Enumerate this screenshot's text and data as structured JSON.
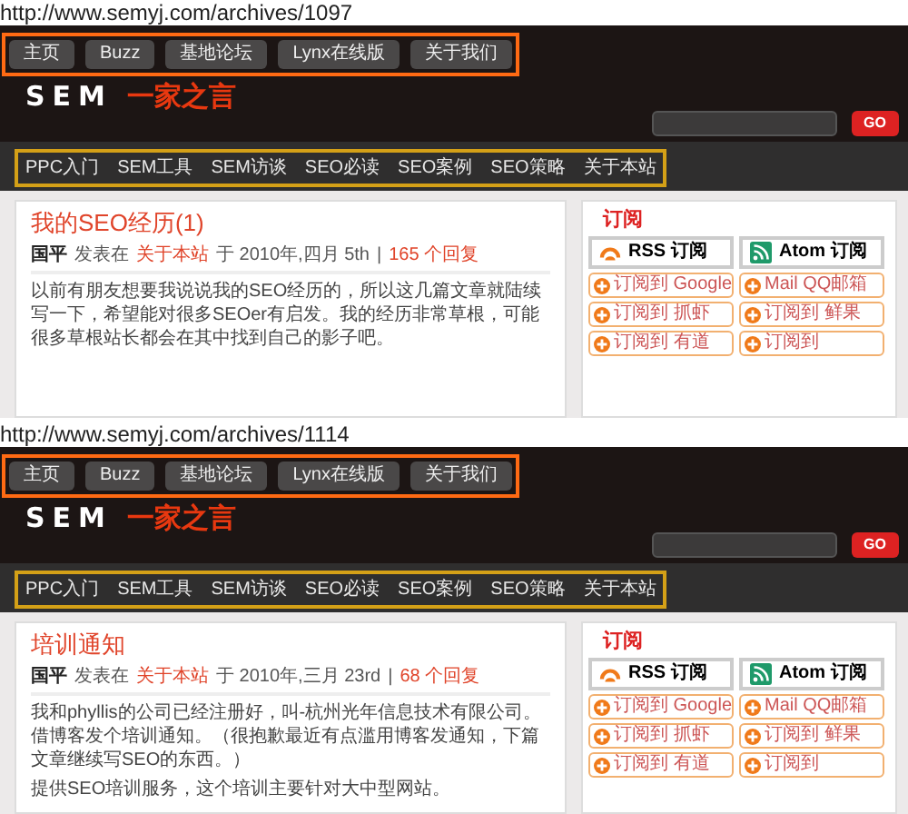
{
  "screenshots": [
    {
      "url": "http://www.semyj.com/archives/1097",
      "top_nav": [
        "主页",
        "Buzz",
        "基地论坛",
        "Lynx在线版",
        "关于我们"
      ],
      "logo": {
        "name": "SEM",
        "tagline": "一家之言"
      },
      "search_button": "GO",
      "sub_nav": [
        "PPC入门",
        "SEM工具",
        "SEM访谈",
        "SEO必读",
        "SEO案例",
        "SEO策略",
        "关于本站"
      ],
      "post": {
        "title": "我的SEO经历(1)",
        "author": "国平",
        "posted_in": "发表在",
        "category": "关于本站",
        "date": "于 2010年,四月 5th",
        "separator": "|",
        "comments": "165 个回复",
        "paragraphs": [
          "以前有朋友想要我说说我的SEO经历的，所以这几篇文章就陆续写一下，希望能对很多SEOer有启发。我的经历非常草根，可能很多草根站长都会在其中找到自己的影子吧。"
        ]
      },
      "sidebar": {
        "title": "订阅",
        "feeds": [
          {
            "kind": "rss",
            "label": "RSS 订阅"
          },
          {
            "kind": "atom",
            "label": "Atom 订阅"
          }
        ],
        "badges": [
          "订阅到 Google",
          "Mail QQ邮箱",
          "订阅到 抓虾",
          "订阅到 鲜果",
          "订阅到 有道",
          "订阅到"
        ]
      }
    },
    {
      "url": "http://www.semyj.com/archives/1114",
      "top_nav": [
        "主页",
        "Buzz",
        "基地论坛",
        "Lynx在线版",
        "关于我们"
      ],
      "logo": {
        "name": "SEM",
        "tagline": "一家之言"
      },
      "search_button": "GO",
      "sub_nav": [
        "PPC入门",
        "SEM工具",
        "SEM访谈",
        "SEO必读",
        "SEO案例",
        "SEO策略",
        "关于本站"
      ],
      "post": {
        "title": "培训通知",
        "author": "国平",
        "posted_in": "发表在",
        "category": "关于本站",
        "date": "于 2010年,三月 23rd",
        "separator": "|",
        "comments": "68 个回复",
        "paragraphs": [
          "我和phyllis的公司已经注册好，叫-杭州光年信息技术有限公司。借博客发个培训通知。（很抱歉最近有点滥用博客发通知，下篇文章继续写SEO的东西。）",
          "提供SEO培训服务，这个培训主要针对大中型网站。"
        ]
      },
      "sidebar": {
        "title": "订阅",
        "feeds": [
          {
            "kind": "rss",
            "label": "RSS 订阅"
          },
          {
            "kind": "atom",
            "label": "Atom 订阅"
          }
        ],
        "badges": [
          "订阅到 Google",
          "Mail QQ邮箱",
          "订阅到 抓虾",
          "订阅到 鲜果",
          "订阅到 有道",
          "订阅到"
        ]
      }
    }
  ]
}
